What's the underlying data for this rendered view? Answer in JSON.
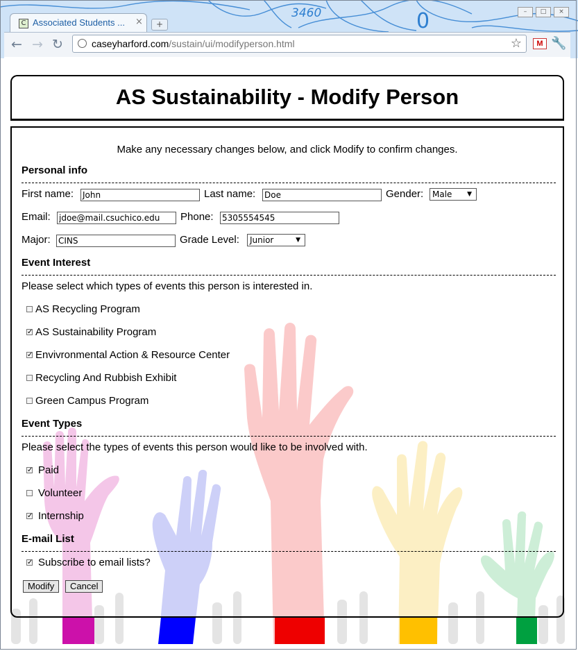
{
  "browser": {
    "tab_title": "Associated Students ...",
    "tab_close": "×",
    "new_tab": "+",
    "window_buttons": [
      "–",
      "□",
      "×"
    ],
    "url_host": "caseyharford.com",
    "url_path": "/sustain/ui/modifyperson.html",
    "back": "←",
    "forward": "→",
    "reload": "↻",
    "star": "☆",
    "gmail": "M",
    "wrench": "🔧"
  },
  "page": {
    "title": "AS Sustainability - Modify Person",
    "intro": "Make any necessary changes below, and click Modify to confirm changes."
  },
  "personal": {
    "heading": "Personal info",
    "first_name_label": "First name:",
    "first_name_value": "John",
    "last_name_label": "Last name:",
    "last_name_value": "Doe",
    "gender_label": "Gender:",
    "gender_value": "Male",
    "email_label": "Email:",
    "email_value": "jdoe@mail.csuchico.edu",
    "phone_label": "Phone:",
    "phone_value": "5305554545",
    "major_label": "Major:",
    "major_value": "CINS",
    "grade_label": "Grade Level:",
    "grade_value": "Junior"
  },
  "interest": {
    "heading": "Event Interest",
    "prompt": "Please select which types of events this person is interested in.",
    "items": [
      {
        "label": "AS Recycling Program",
        "checked": false
      },
      {
        "label": "AS Sustainability Program",
        "checked": true
      },
      {
        "label": "Envivronmental Action & Resource Center",
        "checked": true
      },
      {
        "label": "Recycling And Rubbish Exhibit",
        "checked": false
      },
      {
        "label": "Green Campus Program",
        "checked": false
      }
    ]
  },
  "types": {
    "heading": "Event Types",
    "prompt": "Please select the types of events this person would like to be involved with.",
    "items": [
      {
        "label": "Paid",
        "checked": true
      },
      {
        "label": "Volunteer",
        "checked": false
      },
      {
        "label": "Internship",
        "checked": true
      }
    ]
  },
  "email_list": {
    "heading": "E-mail List",
    "subscribe_label": "Subscribe to email lists?",
    "subscribe_checked": true
  },
  "actions": {
    "modify_label": "Modify",
    "cancel_label": "Cancel"
  },
  "colors": {
    "hand_pink": "#f4c2e6",
    "hand_blue": "#c9ccf8",
    "hand_red": "#fbc9c9",
    "hand_yellow": "#fbefc0",
    "hand_green": "#c9ecd2",
    "band_pink": "#cc11aa",
    "band_blue": "#0000ff",
    "band_red": "#ee0000",
    "band_yellow": "#ffc000",
    "band_green": "#00a040"
  }
}
